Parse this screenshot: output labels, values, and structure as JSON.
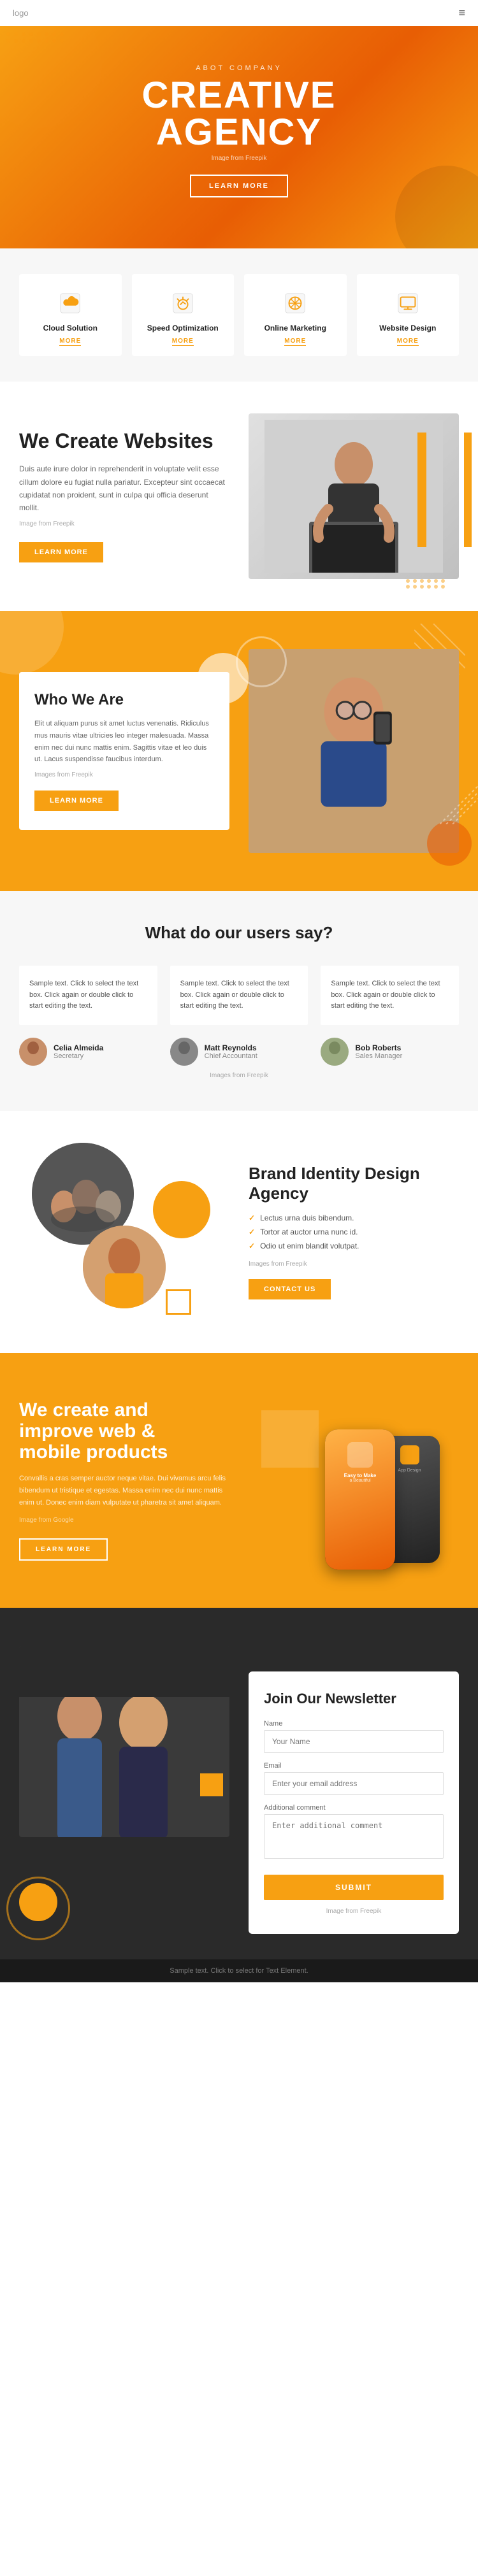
{
  "header": {
    "logo": "logo",
    "menu_icon": "≡"
  },
  "hero": {
    "sub_title": "Abot Company",
    "title_line1": "CREATIVE",
    "title_line2": "AGENCY",
    "image_credit": "Image from Freepik",
    "cta_button": "LEARN MORE"
  },
  "services": {
    "items": [
      {
        "icon": "cloud",
        "title": "Cloud Solution",
        "more": "MORE"
      },
      {
        "icon": "speed",
        "title": "Speed Optimization",
        "more": "MORE"
      },
      {
        "icon": "marketing",
        "title": "Online Marketing",
        "more": "MORE"
      },
      {
        "icon": "design",
        "title": "Website Design",
        "more": "MORE"
      }
    ]
  },
  "we_create": {
    "title": "We Create Websites",
    "body1": "Duis aute irure dolor in reprehenderit in voluptate velit esse cillum dolore eu fugiat nulla pariatur. Excepteur sint occaecat cupidatat non proident, sunt in culpa qui officia deserunt mollit.",
    "image_credit": "Image from Freepik",
    "cta_button": "LEARN MORE"
  },
  "who_we_are": {
    "title": "Who We Are",
    "body": "Elit ut aliquam purus sit amet luctus venenatis. Ridiculus mus mauris vitae ultricies leo integer malesuada. Massa enim nec dui nunc mattis enim. Sagittis vitae et leo duis ut. Lacus suspendisse faucibus interdum.",
    "image_credit": "Images from Freepik",
    "cta_button": "LEARN MORE"
  },
  "testimonials": {
    "heading": "What do our users say?",
    "items": [
      {
        "text": "Sample text. Click to select the text box. Click again or double click to start editing the text.",
        "name": "Celia Almeida",
        "role": "Secretary",
        "avatar_bg": "#c8906a"
      },
      {
        "text": "Sample text. Click to select the text box. Click again or double click to start editing the text.",
        "name": "Matt Reynolds",
        "role": "Chief Accountant",
        "avatar_bg": "#888"
      },
      {
        "text": "Sample text. Click to select the text box. Click again or double click to start editing the text.",
        "name": "Bob Roberts",
        "role": "Sales Manager",
        "avatar_bg": "#9aaa80"
      }
    ],
    "image_credit": "Images from Freepik"
  },
  "brand_identity": {
    "title": "Brand Identity Design Agency",
    "list": [
      "Lectus urna duis bibendum.",
      "Tortor at auctor urna nunc id.",
      "Odio ut enim blandit volutpat."
    ],
    "image_credit": "Images from Freepik",
    "cta_button": "CONTACT US"
  },
  "mobile_products": {
    "title_line1": "We create and",
    "title_line2": "improve web &",
    "title_line3": "mobile products",
    "body": "Convallis a cras semper auctor neque vitae. Dui vivamus arcu felis bibendum ut tristique et egestas. Massa enim nec dui nunc mattis enim ut. Donec enim diam vulputate ut pharetra sit amet aliquam.",
    "image_credit": "Image from Google",
    "cta_button": "LEARN MORE"
  },
  "newsletter": {
    "title": "Join Our Newsletter",
    "fields": [
      {
        "label": "Name",
        "placeholder": "Your Name",
        "type": "text"
      },
      {
        "label": "Email",
        "placeholder": "Enter your email address",
        "type": "email"
      },
      {
        "label": "Additional comment",
        "placeholder": "Enter additional comment",
        "type": "textarea"
      }
    ],
    "submit_button": "SUBMIT",
    "image_credit": "Image from Freepik"
  },
  "footer": {
    "text": "Sample text. Click to select for Text Element."
  }
}
